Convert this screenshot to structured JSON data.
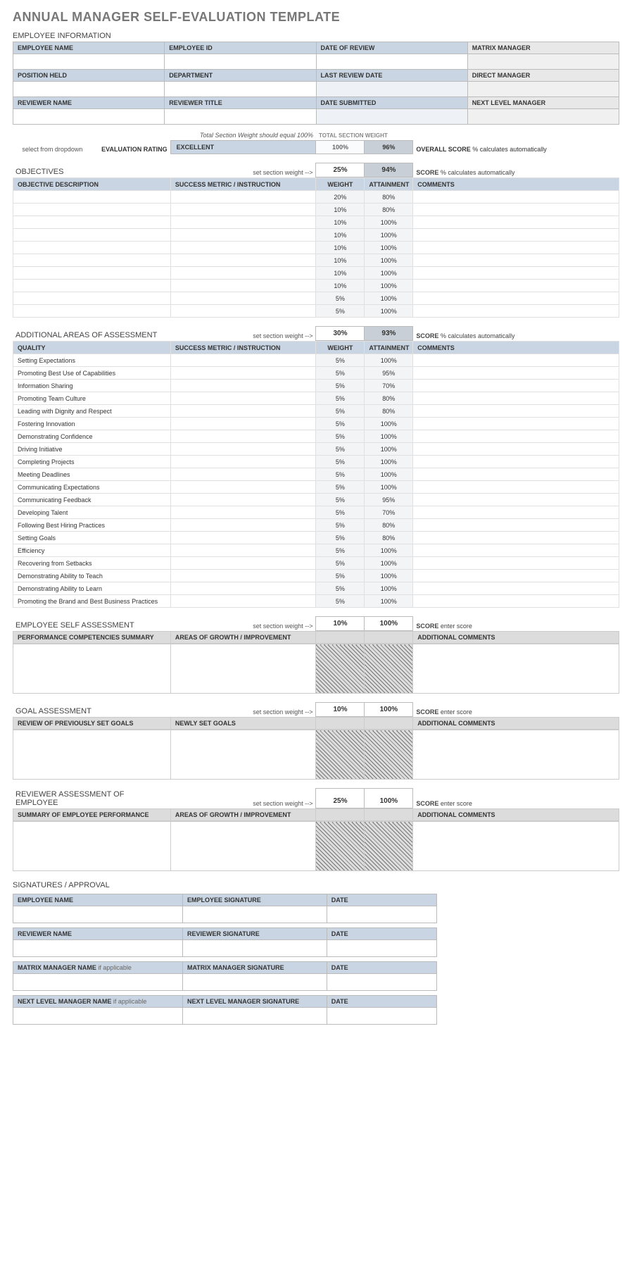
{
  "title": "ANNUAL MANAGER SELF-EVALUATION TEMPLATE",
  "empinfo": {
    "section": "EMPLOYEE INFORMATION",
    "cols": [
      "EMPLOYEE NAME",
      "EMPLOYEE ID",
      "DATE OF REVIEW",
      "MATRIX MANAGER"
    ],
    "cols2": [
      "POSITION HELD",
      "DEPARTMENT",
      "LAST REVIEW DATE",
      "DIRECT MANAGER"
    ],
    "cols3": [
      "REVIEWER NAME",
      "REVIEWER TITLE",
      "DATE SUBMITTED",
      "NEXT LEVEL MANAGER"
    ]
  },
  "rating": {
    "note": "Total Section Weight should equal 100%",
    "tsw": "TOTAL SECTION WEIGHT",
    "select_hint": "select from dropdown",
    "eval_label": "EVALUATION RATING",
    "eval_value": "EXCELLENT",
    "totalw": "100%",
    "totalscore": "96%",
    "overall_label": "OVERALL SCORE",
    "overall_hint": "% calculates automatically"
  },
  "objectives": {
    "title": "OBJECTIVES",
    "hint": "set section weight -->",
    "weight": "25%",
    "score": "94%",
    "score_lab": "SCORE",
    "score_hint": "% calculates automatically",
    "headers": [
      "OBJECTIVE DESCRIPTION",
      "SUCCESS METRIC / INSTRUCTION",
      "WEIGHT",
      "ATTAINMENT",
      "COMMENTS"
    ],
    "rows": [
      {
        "desc": "",
        "metric": "",
        "w": "20%",
        "a": "80%",
        "c": ""
      },
      {
        "desc": "",
        "metric": "",
        "w": "10%",
        "a": "80%",
        "c": ""
      },
      {
        "desc": "",
        "metric": "",
        "w": "10%",
        "a": "100%",
        "c": ""
      },
      {
        "desc": "",
        "metric": "",
        "w": "10%",
        "a": "100%",
        "c": ""
      },
      {
        "desc": "",
        "metric": "",
        "w": "10%",
        "a": "100%",
        "c": ""
      },
      {
        "desc": "",
        "metric": "",
        "w": "10%",
        "a": "100%",
        "c": ""
      },
      {
        "desc": "",
        "metric": "",
        "w": "10%",
        "a": "100%",
        "c": ""
      },
      {
        "desc": "",
        "metric": "",
        "w": "10%",
        "a": "100%",
        "c": ""
      },
      {
        "desc": "",
        "metric": "",
        "w": "5%",
        "a": "100%",
        "c": ""
      },
      {
        "desc": "",
        "metric": "",
        "w": "5%",
        "a": "100%",
        "c": ""
      }
    ]
  },
  "areas": {
    "title": "ADDITIONAL AREAS OF ASSESSMENT",
    "hint": "set section weight -->",
    "weight": "30%",
    "score": "93%",
    "score_lab": "SCORE",
    "score_hint": "% calculates automatically",
    "headers": [
      "QUALITY",
      "SUCCESS METRIC / INSTRUCTION",
      "WEIGHT",
      "ATTAINMENT",
      "COMMENTS"
    ],
    "rows": [
      {
        "desc": "Setting Expectations",
        "w": "5%",
        "a": "100%"
      },
      {
        "desc": "Promoting Best Use of Capabilities",
        "w": "5%",
        "a": "95%"
      },
      {
        "desc": "Information Sharing",
        "w": "5%",
        "a": "70%"
      },
      {
        "desc": "Promoting Team Culture",
        "w": "5%",
        "a": "80%"
      },
      {
        "desc": "Leading with Dignity and Respect",
        "w": "5%",
        "a": "80%"
      },
      {
        "desc": "Fostering Innovation",
        "w": "5%",
        "a": "100%"
      },
      {
        "desc": "Demonstrating Confidence",
        "w": "5%",
        "a": "100%"
      },
      {
        "desc": "Driving Initiative",
        "w": "5%",
        "a": "100%"
      },
      {
        "desc": "Completing Projects",
        "w": "5%",
        "a": "100%"
      },
      {
        "desc": "Meeting Deadlines",
        "w": "5%",
        "a": "100%"
      },
      {
        "desc": "Communicating Expectations",
        "w": "5%",
        "a": "100%"
      },
      {
        "desc": "Communicating Feedback",
        "w": "5%",
        "a": "95%"
      },
      {
        "desc": "Developing Talent",
        "w": "5%",
        "a": "70%"
      },
      {
        "desc": "Following Best Hiring Practices",
        "w": "5%",
        "a": "80%"
      },
      {
        "desc": "Setting Goals",
        "w": "5%",
        "a": "80%"
      },
      {
        "desc": "Efficiency",
        "w": "5%",
        "a": "100%"
      },
      {
        "desc": "Recovering from Setbacks",
        "w": "5%",
        "a": "100%"
      },
      {
        "desc": "Demonstrating Ability to Teach",
        "w": "5%",
        "a": "100%"
      },
      {
        "desc": "Demonstrating Ability to Learn",
        "w": "5%",
        "a": "100%"
      },
      {
        "desc": "Promoting the Brand and Best Business Practices",
        "w": "5%",
        "a": "100%"
      }
    ]
  },
  "self": {
    "title": "EMPLOYEE SELF ASSESSMENT",
    "hint": "set section weight -->",
    "weight": "10%",
    "score": "100%",
    "score_lab": "SCORE",
    "score_hint": "enter score",
    "h1": "PERFORMANCE COMPETENCIES SUMMARY",
    "h2": "AREAS OF GROWTH / IMPROVEMENT",
    "h3": "ADDITIONAL COMMENTS"
  },
  "goal": {
    "title": "GOAL ASSESSMENT",
    "hint": "set section weight -->",
    "weight": "10%",
    "score": "100%",
    "score_lab": "SCORE",
    "score_hint": "enter score",
    "h1": "REVIEW OF PREVIOUSLY SET GOALS",
    "h2": "NEWLY SET GOALS",
    "h3": "ADDITIONAL COMMENTS"
  },
  "reviewer": {
    "title": "REVIEWER ASSESSMENT OF EMPLOYEE",
    "hint": "set section weight -->",
    "weight": "25%",
    "score": "100%",
    "score_lab": "SCORE",
    "score_hint": "enter score",
    "h1": "SUMMARY OF EMPLOYEE PERFORMANCE",
    "h2": "AREAS OF GROWTH / IMPROVEMENT",
    "h3": "ADDITIONAL COMMENTS"
  },
  "sign": {
    "title": "SIGNATURES / APPROVAL",
    "ifapp": "if applicable",
    "rows": [
      [
        "EMPLOYEE NAME",
        "EMPLOYEE SIGNATURE",
        "DATE"
      ],
      [
        "REVIEWER NAME",
        "REVIEWER SIGNATURE",
        "DATE"
      ],
      [
        "MATRIX MANAGER NAME",
        "MATRIX MANAGER SIGNATURE",
        "DATE"
      ],
      [
        "NEXT LEVEL MANAGER NAME",
        "NEXT LEVEL MANAGER SIGNATURE",
        "DATE"
      ]
    ]
  }
}
